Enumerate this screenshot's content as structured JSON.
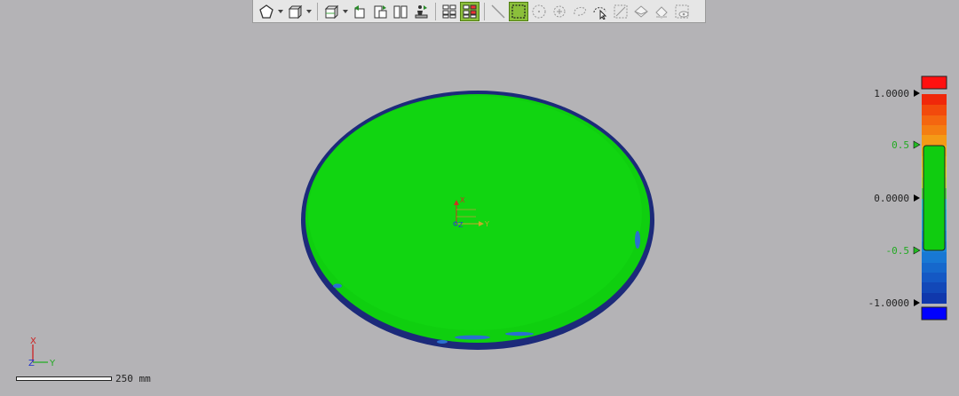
{
  "toolbar": {
    "buttons": [
      {
        "name": "polygon-select-button",
        "icon": "polygon-icon",
        "dropdown": true
      },
      {
        "name": "box-view-button",
        "icon": "cube-icon",
        "dropdown": true
      },
      {
        "name": "iso-view-button",
        "icon": "iso-cube-icon",
        "dropdown": true
      },
      {
        "name": "align-button",
        "icon": "align-icon"
      },
      {
        "name": "rotate-copy-button",
        "icon": "rotate-icon"
      },
      {
        "name": "split-view-button",
        "icon": "split-icon"
      },
      {
        "name": "measure-person-button",
        "icon": "person-icon"
      },
      {
        "name": "grid-view-button",
        "icon": "grid-icon"
      },
      {
        "name": "results-list-button",
        "icon": "list-icon",
        "active": true
      },
      {
        "name": "line-select-button",
        "icon": "line-icon"
      },
      {
        "name": "rect-select-button",
        "icon": "rect-select-icon",
        "active": true
      },
      {
        "name": "circle-select-button",
        "icon": "circle-dashed-icon"
      },
      {
        "name": "point-select-button",
        "icon": "crosshair-icon"
      },
      {
        "name": "lasso-select-button",
        "icon": "lasso-icon"
      },
      {
        "name": "brush-select-button",
        "icon": "brush-cursor-icon"
      },
      {
        "name": "edge-select-button",
        "icon": "edge-icon"
      },
      {
        "name": "surface-select-button",
        "icon": "surface-icon"
      },
      {
        "name": "volume-select-button",
        "icon": "volume-icon"
      },
      {
        "name": "visible-select-button",
        "icon": "eye-icon"
      }
    ]
  },
  "legend": {
    "labels": {
      "max": "1.0000",
      "upper_tol": "0.5",
      "zero": "0.0000",
      "lower_tol": "-0.5",
      "min": "-1.0000"
    },
    "colors": {
      "over": "#ff1010",
      "within": "#10cc10",
      "under": "#0000ff",
      "upper_tol_color": "#22bb22",
      "lower_tol_color": "#22bb22",
      "text": "#222222"
    }
  },
  "viewport": {
    "part_fill": "#0fcf0f",
    "edge_color": "#1a2a6e",
    "origin_axis_labels": {
      "x": "X",
      "y": "Y",
      "z": "Z"
    }
  },
  "triad": {
    "x": "X",
    "y": "Y",
    "z": "Z"
  },
  "scale": {
    "label": "250 mm"
  }
}
